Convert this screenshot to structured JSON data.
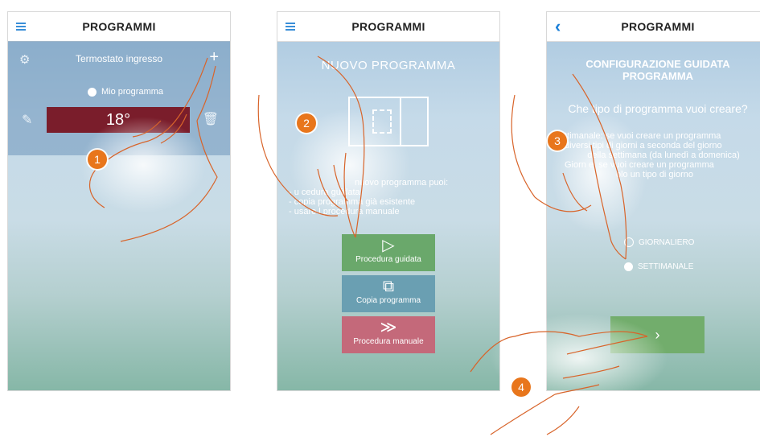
{
  "screens": [
    {
      "title": "PROGRAMMI",
      "nav_icon": "hamburger-icon",
      "thermostat_name": "Termostato ingresso",
      "program_name": "Mio programma",
      "temperature": "18°"
    },
    {
      "title": "PROGRAMMI",
      "nav_icon": "hamburger-icon",
      "heading": "NUOVO PROGRAMMA",
      "lines": [
        "nuovo programma puoi:",
        "- u   cedura guidata",
        "- copia   programma già esistente",
        "- usare l   procedura manuale"
      ],
      "buttons": {
        "guided": "Procedura guidata",
        "copy": "Copia programma",
        "manual": "Procedura manuale"
      },
      "button_colors": {
        "guided": "#6aa86b",
        "copy": "#6a9fb2",
        "manual": "#c4697a"
      }
    },
    {
      "title": "PROGRAMMI",
      "nav_icon": "back-chevron-icon",
      "heading_line1": "CONFIGURAZIONE GUIDATA",
      "heading_line2": "PROGRAMMA",
      "question": "Che tipo di programma vuoi creare?",
      "desc_lines": [
        "ttimanale: se vuoi creare un programma",
        "diversi tipi di giorni a seconda del giorno",
        "della settimana (da lunedì a domenica)",
        "Giorn   e: se vuoi creare un programma",
        "olo un tipo di giorno"
      ],
      "options": [
        "GIORNALIERO",
        "SETTIMANALE"
      ],
      "selected_option": "SETTIMANALE",
      "next_icon": "chevron-right-icon"
    }
  ],
  "steps": [
    "1",
    "2",
    "3",
    "4"
  ],
  "colors": {
    "accent": "#3a8fd8",
    "step_badge": "#e8761c",
    "temperature_box": "#7a1d2b"
  }
}
